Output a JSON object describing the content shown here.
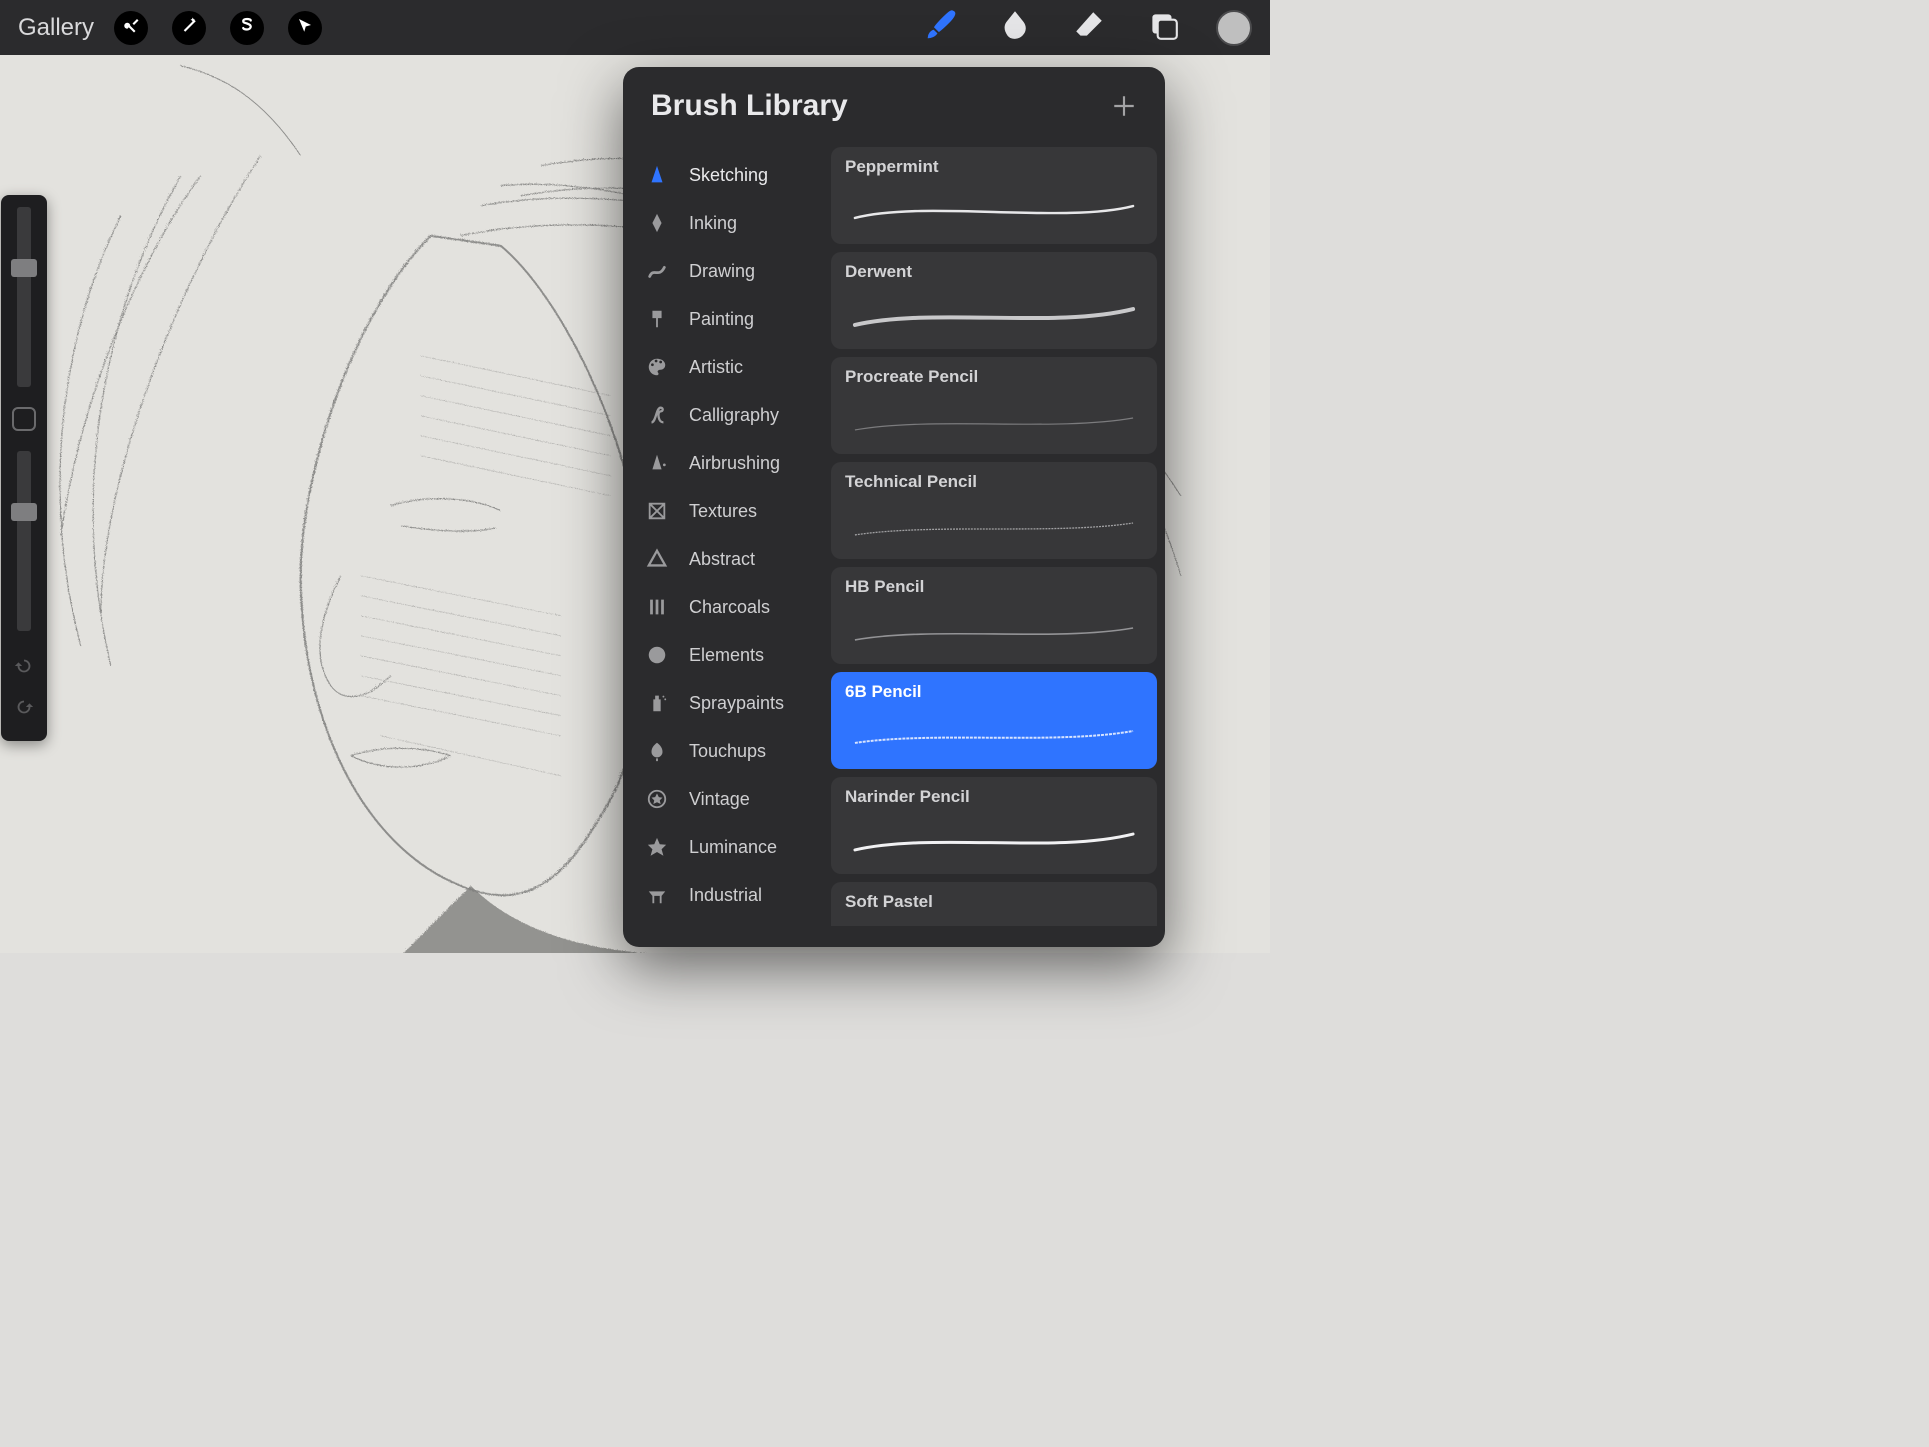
{
  "topbar": {
    "gallery_label": "Gallery"
  },
  "brush_library": {
    "title": "Brush Library",
    "categories": [
      {
        "label": "Sketching",
        "icon": "sketching-icon",
        "active": true
      },
      {
        "label": "Inking",
        "icon": "inking-icon",
        "active": false
      },
      {
        "label": "Drawing",
        "icon": "drawing-icon",
        "active": false
      },
      {
        "label": "Painting",
        "icon": "painting-icon",
        "active": false
      },
      {
        "label": "Artistic",
        "icon": "artistic-icon",
        "active": false
      },
      {
        "label": "Calligraphy",
        "icon": "calligraphy-icon",
        "active": false
      },
      {
        "label": "Airbrushing",
        "icon": "airbrushing-icon",
        "active": false
      },
      {
        "label": "Textures",
        "icon": "textures-icon",
        "active": false
      },
      {
        "label": "Abstract",
        "icon": "abstract-icon",
        "active": false
      },
      {
        "label": "Charcoals",
        "icon": "charcoals-icon",
        "active": false
      },
      {
        "label": "Elements",
        "icon": "elements-icon",
        "active": false
      },
      {
        "label": "Spraypaints",
        "icon": "spraypaints-icon",
        "active": false
      },
      {
        "label": "Touchups",
        "icon": "touchups-icon",
        "active": false
      },
      {
        "label": "Vintage",
        "icon": "vintage-icon",
        "active": false
      },
      {
        "label": "Luminance",
        "icon": "luminance-icon",
        "active": false
      },
      {
        "label": "Industrial",
        "icon": "industrial-icon",
        "active": false
      }
    ],
    "brushes": [
      {
        "name": "Peppermint",
        "selected": false
      },
      {
        "name": "Derwent",
        "selected": false
      },
      {
        "name": "Procreate Pencil",
        "selected": false
      },
      {
        "name": "Technical Pencil",
        "selected": false
      },
      {
        "name": "HB Pencil",
        "selected": false
      },
      {
        "name": "6B Pencil",
        "selected": true
      },
      {
        "name": "Narinder Pencil",
        "selected": false
      },
      {
        "name": "Soft Pastel",
        "selected": false
      }
    ]
  },
  "colors": {
    "accent": "#2f74ff",
    "swatch": "#bfbfbf"
  }
}
